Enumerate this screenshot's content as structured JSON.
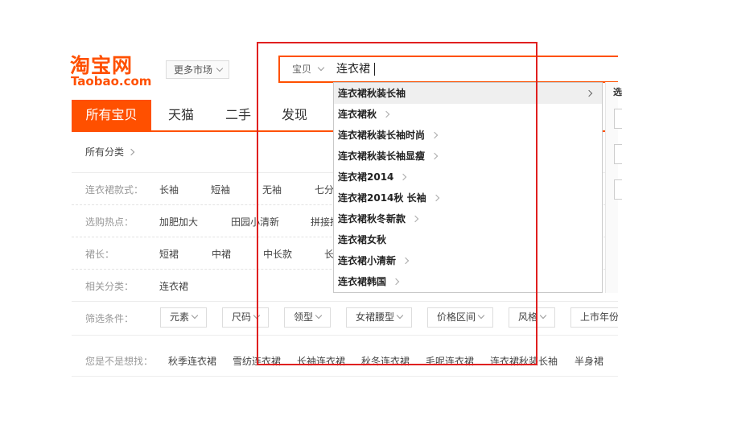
{
  "logo": {
    "cn": "淘宝网",
    "en": "Taobao.com"
  },
  "market": {
    "label": "更多市场"
  },
  "search": {
    "type": "宝贝",
    "query": "连衣裙"
  },
  "tabs": [
    "所有宝贝",
    "天猫",
    "二手",
    "发现"
  ],
  "filters": {
    "all_categories": "所有分类",
    "rows": [
      {
        "label": "连衣裙款式：",
        "values": [
          "长袖",
          "短袖",
          "无袖",
          "七分"
        ]
      },
      {
        "label": "选购热点：",
        "values": [
          "加肥加大",
          "田园小清新",
          "拼接拼"
        ]
      },
      {
        "label": "裙长：",
        "values": [
          "短裙",
          "中裙",
          "中长款",
          "长"
        ]
      },
      {
        "label": "相关分类：",
        "values": [
          "连衣裙"
        ]
      }
    ],
    "condition_label": "筛选条件：",
    "dropdowns": [
      "元素",
      "尺码",
      "领型",
      "女裙腰型",
      "价格区间",
      "风格",
      "上市年份"
    ]
  },
  "suggestions": {
    "label": "您是不是想找：",
    "items": [
      "秋季连衣裙",
      "雪纺连衣裙",
      "长袖连衣裙",
      "秋冬连衣裙",
      "毛呢连衣裙",
      "连衣裙秋装长袖",
      "半身裙"
    ]
  },
  "autocomplete": {
    "items": [
      "连衣裙秋装长袖",
      "连衣裙秋",
      "连衣裙秋装长袖时尚",
      "连衣裙秋装长袖显瘦",
      "连衣裙2014",
      "连衣裙2014秋 长袖",
      "连衣裙秋冬新款",
      "连衣裙女秋",
      "连衣裙小清新",
      "连衣裙韩国"
    ],
    "highlighted_index": 0
  },
  "right_panel": {
    "fragment": "选"
  },
  "colors": {
    "brand": "#ff5000",
    "annotation": "#e02020"
  }
}
